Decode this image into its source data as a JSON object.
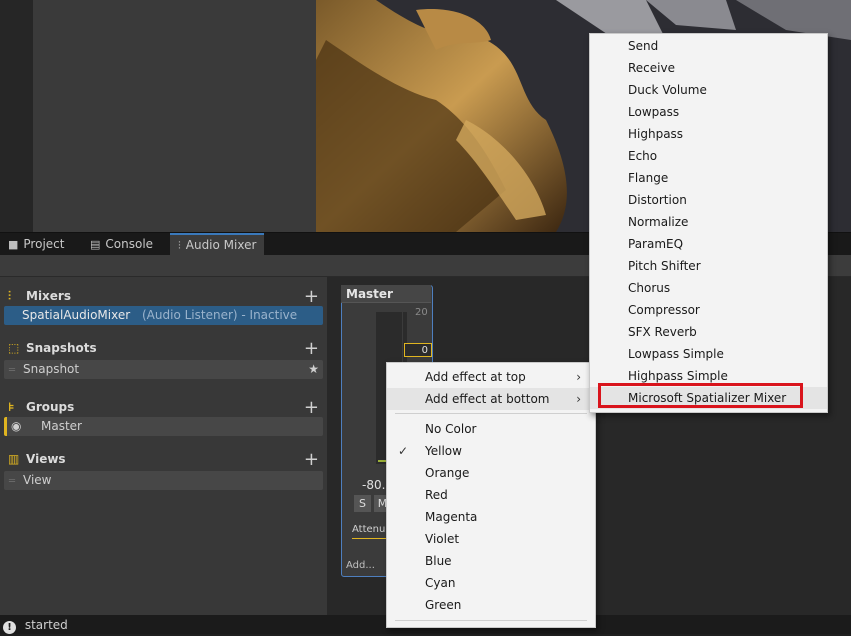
{
  "tabs": [
    {
      "label": "Project",
      "icon": "folder-icon"
    },
    {
      "label": "Console",
      "icon": "console-icon"
    },
    {
      "label": "Audio Mixer",
      "icon": "mixer-icon",
      "active": true
    }
  ],
  "sections": {
    "mixers": {
      "title": "Mixers",
      "icon": "mixer-icon",
      "items": [
        {
          "name": "SpatialAudioMixer",
          "detail": "(Audio Listener) - Inactive"
        }
      ]
    },
    "snapshots": {
      "title": "Snapshots",
      "icon": "snapshot-icon",
      "items": [
        {
          "name": "Snapshot"
        }
      ]
    },
    "groups": {
      "title": "Groups",
      "icon": "groups-icon",
      "items": [
        {
          "name": "Master"
        }
      ]
    },
    "views": {
      "title": "Views",
      "icon": "views-icon",
      "items": [
        {
          "name": "View"
        }
      ]
    }
  },
  "strip": {
    "title": "Master",
    "scale_top": "20",
    "fader_value": "0",
    "db_value": "-80.",
    "solo": "S",
    "mute": "M",
    "attenuation": "Attenu",
    "add": "Add..."
  },
  "context_menu": {
    "items": [
      "Add effect at top",
      "Add effect at bottom"
    ],
    "colors": [
      "No Color",
      "Yellow",
      "Orange",
      "Red",
      "Magenta",
      "Violet",
      "Blue",
      "Cyan",
      "Green"
    ],
    "checked": "Yellow"
  },
  "effects_menu": {
    "items": [
      "Send",
      "Receive",
      "Duck Volume",
      "Lowpass",
      "Highpass",
      "Echo",
      "Flange",
      "Distortion",
      "Normalize",
      "ParamEQ",
      "Pitch Shifter",
      "Chorus",
      "Compressor",
      "SFX Reverb",
      "Lowpass Simple",
      "Highpass Simple",
      "Microsoft Spatializer Mixer"
    ],
    "highlighted": "Microsoft Spatializer Mixer"
  },
  "status": {
    "text": "started",
    "icon": "info-icon"
  },
  "colors": {
    "accent": "#e0b520",
    "selection": "#2c5d87",
    "highlight_box": "#d9141c"
  }
}
